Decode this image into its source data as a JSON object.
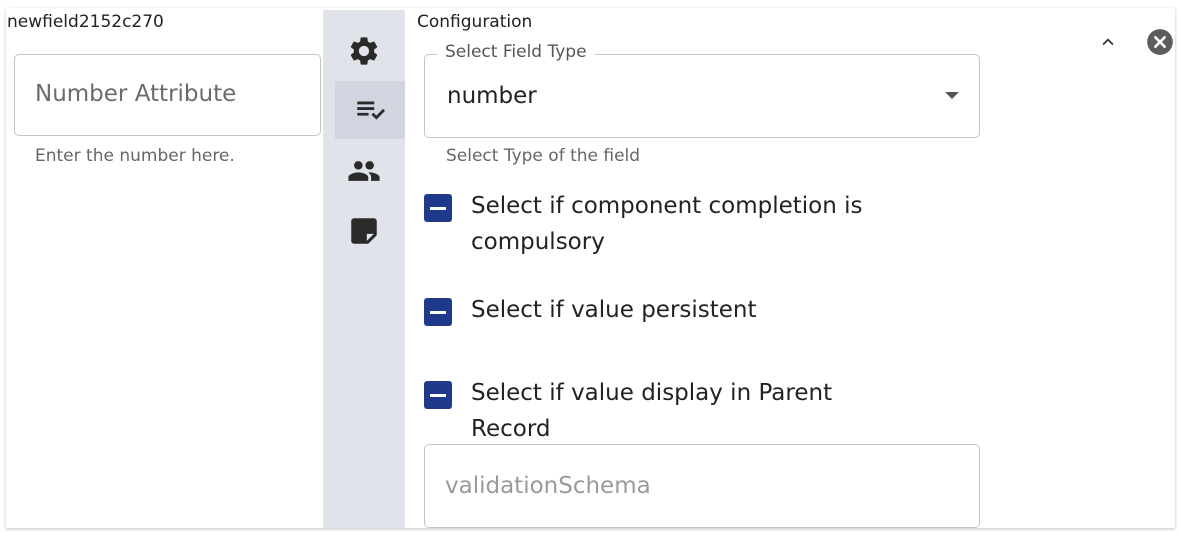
{
  "preview": {
    "field_name": "newfield2152c270",
    "input_label": "Number Attribute",
    "helper_text": "Enter the number here."
  },
  "rail": {
    "items": [
      {
        "icon": "gear-icon"
      },
      {
        "icon": "list-check-icon",
        "active": true
      },
      {
        "icon": "people-icon"
      },
      {
        "icon": "note-icon"
      }
    ]
  },
  "config": {
    "title": "Configuration",
    "field_type": {
      "legend": "Select Field Type",
      "value": "number",
      "helper_text": "Select Type of the field"
    },
    "checkboxes": [
      {
        "label": "Select if component completion is compulsory",
        "state": "indeterminate"
      },
      {
        "label": "Select if value persistent",
        "state": "indeterminate"
      },
      {
        "label": "Select if value display in Parent Record",
        "state": "indeterminate"
      }
    ],
    "validation_placeholder": "validationSchema"
  },
  "colors": {
    "checkbox": "#1f3a8a",
    "rail_bg": "#e0e3ea",
    "rail_active": "#d0d5e0"
  }
}
